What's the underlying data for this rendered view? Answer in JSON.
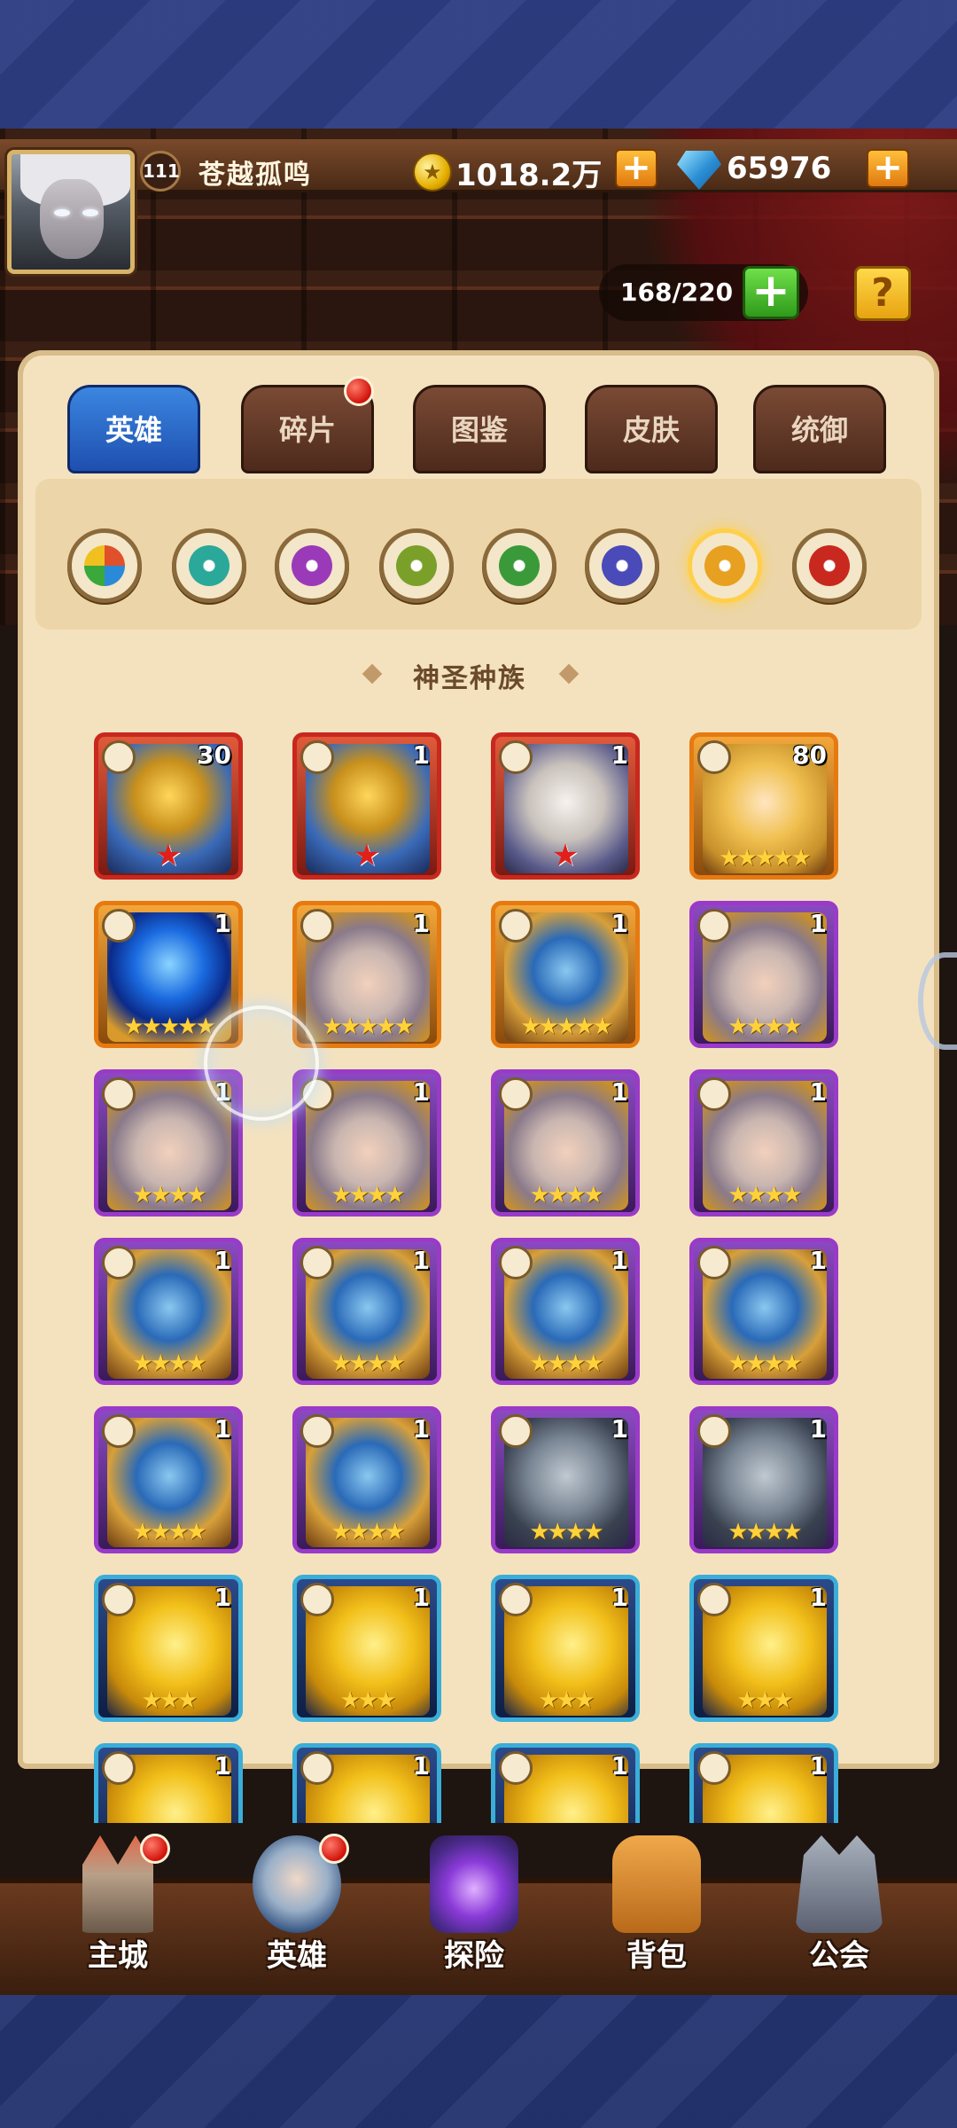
{
  "player": {
    "level": "111",
    "name": "苍越孤鸣"
  },
  "resources": {
    "gold": "1018.2万",
    "gems": "65976",
    "capacity": "168/220"
  },
  "tabs": [
    {
      "label": "英雄",
      "active": true
    },
    {
      "label": "碎片",
      "active": false,
      "notification": true
    },
    {
      "label": "图鉴",
      "active": false
    },
    {
      "label": "皮肤",
      "active": false
    },
    {
      "label": "统御",
      "active": false
    }
  ],
  "factions": [
    {
      "icon": "all-factions-icon",
      "color": "#e0502a"
    },
    {
      "icon": "forest-faction-icon",
      "color": "#2aa89a"
    },
    {
      "icon": "shadow-faction-icon",
      "color": "#9a3ab8"
    },
    {
      "icon": "fortress-faction-icon",
      "color": "#7aa02a"
    },
    {
      "icon": "nature-faction-icon",
      "color": "#3a9a3a"
    },
    {
      "icon": "abyss-faction-icon",
      "color": "#4a4ab8"
    },
    {
      "icon": "holy-faction-icon",
      "color": "#e8a020",
      "active": true
    },
    {
      "icon": "chaos-faction-icon",
      "color": "#c8281e"
    }
  ],
  "section_title": "神圣种族",
  "heroes": [
    {
      "count": "30",
      "rarity": "red",
      "art": "knight",
      "stars": "red"
    },
    {
      "count": "1",
      "rarity": "red",
      "art": "knight",
      "stars": "red"
    },
    {
      "count": "1",
      "rarity": "red",
      "art": "sage",
      "stars": "red"
    },
    {
      "count": "80",
      "rarity": "orange",
      "art": "blonde",
      "stars": "★★★★★"
    },
    {
      "count": "1",
      "rarity": "orange",
      "art": "orb",
      "stars": "★★★★★"
    },
    {
      "count": "1",
      "rarity": "orange",
      "art": "woman",
      "stars": "★★★★★"
    },
    {
      "count": "1",
      "rarity": "orange",
      "art": "armor",
      "stars": "★★★★★"
    },
    {
      "count": "1",
      "rarity": "purple",
      "art": "woman",
      "stars": "★★★★"
    },
    {
      "count": "1",
      "rarity": "purple",
      "art": "woman",
      "stars": "★★★★"
    },
    {
      "count": "1",
      "rarity": "purple",
      "art": "woman",
      "stars": "★★★★"
    },
    {
      "count": "1",
      "rarity": "purple",
      "art": "woman",
      "stars": "★★★★"
    },
    {
      "count": "1",
      "rarity": "purple",
      "art": "woman",
      "stars": "★★★★"
    },
    {
      "count": "1",
      "rarity": "purple",
      "art": "armor",
      "stars": "★★★★"
    },
    {
      "count": "1",
      "rarity": "purple",
      "art": "armor",
      "stars": "★★★★"
    },
    {
      "count": "1",
      "rarity": "purple",
      "art": "armor",
      "stars": "★★★★"
    },
    {
      "count": "1",
      "rarity": "purple",
      "art": "armor",
      "stars": "★★★★"
    },
    {
      "count": "1",
      "rarity": "purple",
      "art": "armor",
      "stars": "★★★★"
    },
    {
      "count": "1",
      "rarity": "purple",
      "art": "armor",
      "stars": "★★★★"
    },
    {
      "count": "1",
      "rarity": "purple",
      "art": "golem",
      "stars": "★★★★"
    },
    {
      "count": "1",
      "rarity": "purple",
      "art": "golem",
      "stars": "★★★★"
    },
    {
      "count": "1",
      "rarity": "blue",
      "art": "gold",
      "stars": "★★★"
    },
    {
      "count": "1",
      "rarity": "blue",
      "art": "gold",
      "stars": "★★★"
    },
    {
      "count": "1",
      "rarity": "blue",
      "art": "gold",
      "stars": "★★★"
    },
    {
      "count": "1",
      "rarity": "blue",
      "art": "gold",
      "stars": "★★★"
    },
    {
      "count": "1",
      "rarity": "blue",
      "art": "gold",
      "stars": ""
    },
    {
      "count": "1",
      "rarity": "blue",
      "art": "gold",
      "stars": ""
    },
    {
      "count": "1",
      "rarity": "blue",
      "art": "gold",
      "stars": ""
    },
    {
      "count": "1",
      "rarity": "blue",
      "art": "gold",
      "stars": ""
    }
  ],
  "bottom_nav": [
    {
      "label": "主城",
      "icon": "castle-icon",
      "notification": true
    },
    {
      "label": "英雄",
      "icon": "hero-icon",
      "notification": true
    },
    {
      "label": "探险",
      "icon": "portal-icon"
    },
    {
      "label": "背包",
      "icon": "backpack-icon"
    },
    {
      "label": "公会",
      "icon": "guild-icon"
    }
  ]
}
